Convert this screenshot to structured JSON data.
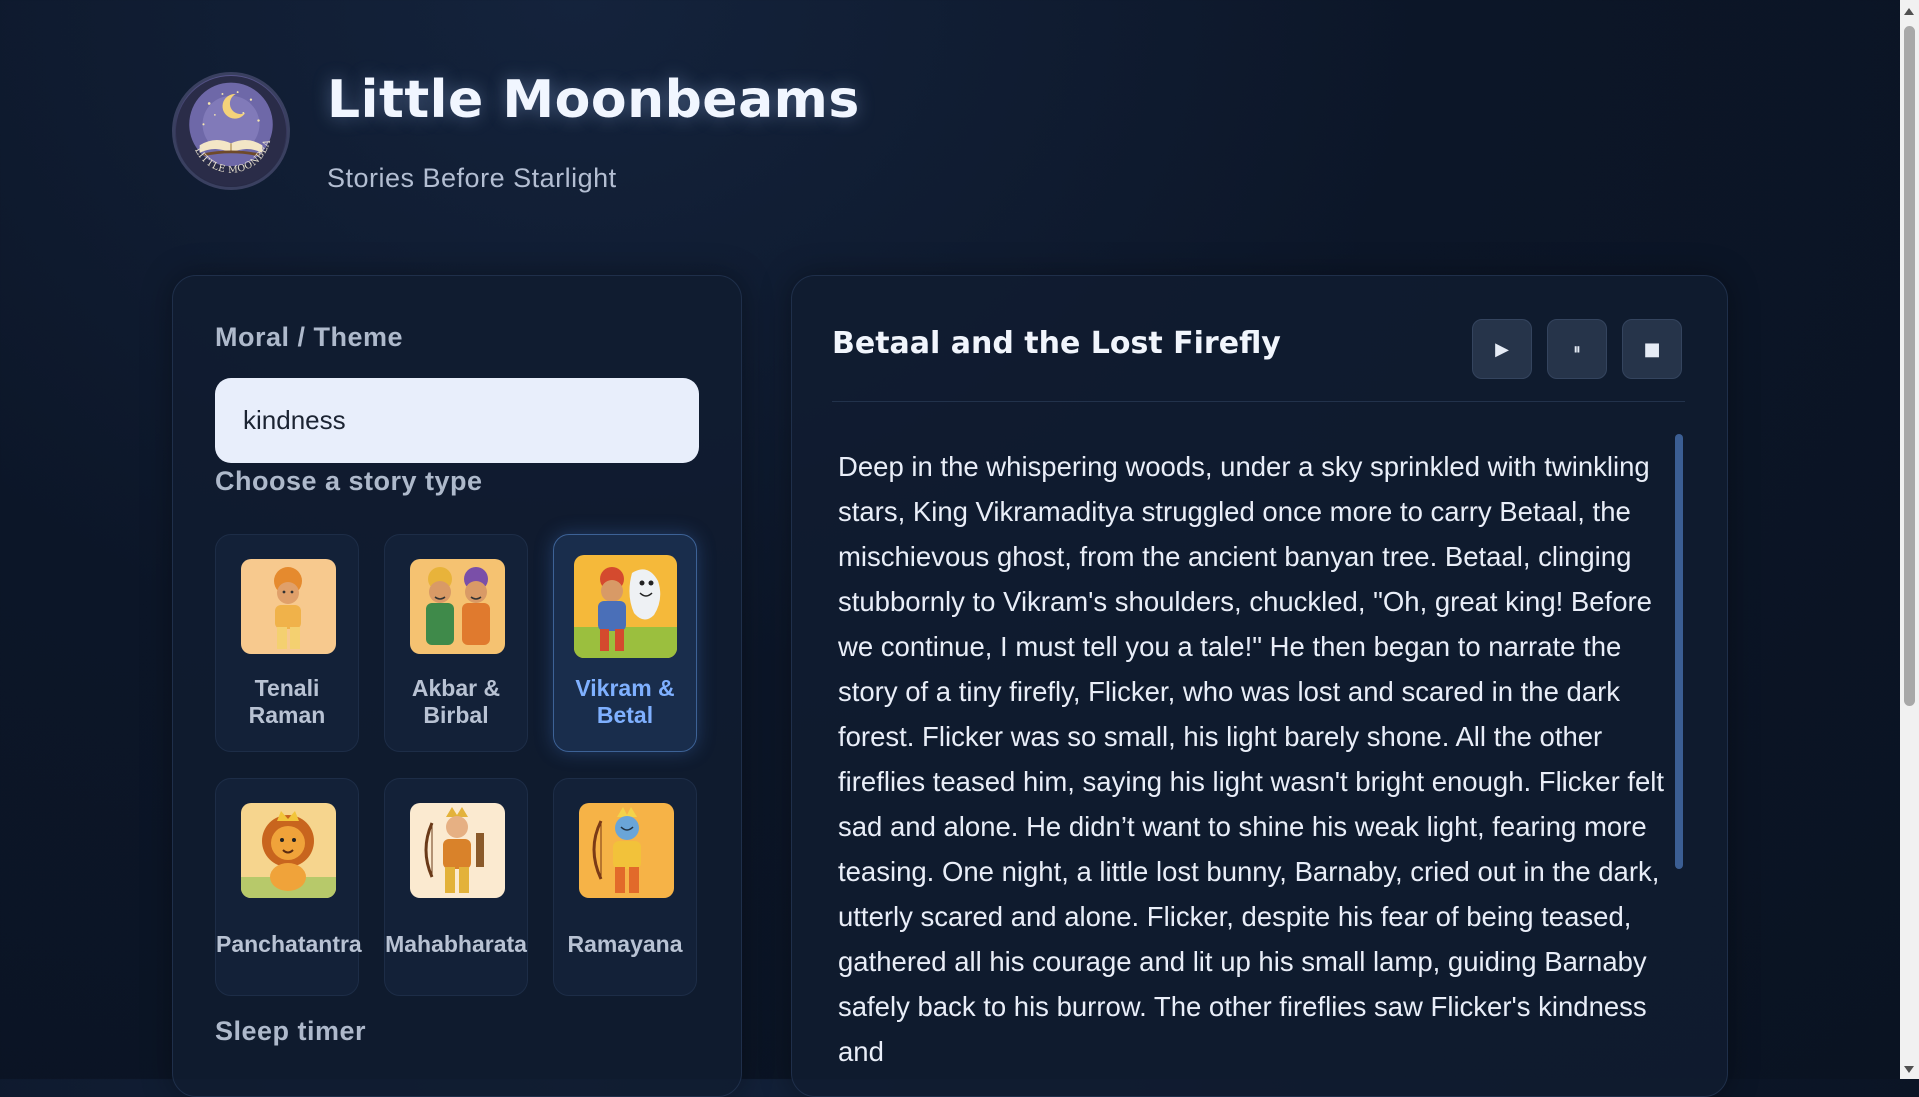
{
  "header": {
    "title": "Little Moonbeams",
    "subtitle": "Stories Before Starlight",
    "logo_icon": "moon-book-logo-icon",
    "logo_text": "LITTLE MOONBEAMS"
  },
  "left": {
    "theme_label": "Moral / Theme",
    "theme_value": "kindness",
    "story_type_label": "Choose a story type",
    "sleep_timer_label": "Sleep timer",
    "story_types": [
      {
        "label": "Tenali Raman",
        "icon": "tenali-raman-icon",
        "selected": false
      },
      {
        "label": "Akbar & Birbal",
        "icon": "akbar-birbal-icon",
        "selected": false
      },
      {
        "label": "Vikram & Betal",
        "icon": "vikram-betal-icon",
        "selected": true
      },
      {
        "label": "Panchatantra",
        "icon": "lion-icon",
        "selected": false
      },
      {
        "label": "Mahabharata",
        "icon": "archer-warrior-icon",
        "selected": false
      },
      {
        "label": "Ramayana",
        "icon": "rama-archer-icon",
        "selected": false
      }
    ]
  },
  "story": {
    "title": "Betaal and the Lost Firefly",
    "controls": {
      "play": "▶",
      "pause": "⏸",
      "stop": "■"
    },
    "text": "Deep in the whispering woods, under a sky sprinkled with twinkling stars, King Vikramaditya struggled once more to carry Betaal, the mischievous ghost, from the ancient banyan tree. Betaal, clinging stubbornly to Vikram's shoulders, chuckled, \"Oh, great king! Before we continue, I must tell you a tale!\" He then began to narrate the story of a tiny firefly, Flicker, who was lost and scared in the dark forest. Flicker was so small, his light barely shone. All the other fireflies teased him, saying his light wasn't bright enough. Flicker felt sad and alone. He didn’t want to shine his weak light, fearing more teasing. One night, a little lost bunny, Barnaby, cried out in the dark, utterly scared and alone. Flicker, despite his fear of being teased, gathered all his courage and lit up his small lamp, guiding Barnaby safely back to his burrow. The other fireflies saw Flicker's kindness and"
  },
  "colors": {
    "accent": "#7fb0ff",
    "background": "#0c1628",
    "panel": "#101c30"
  }
}
